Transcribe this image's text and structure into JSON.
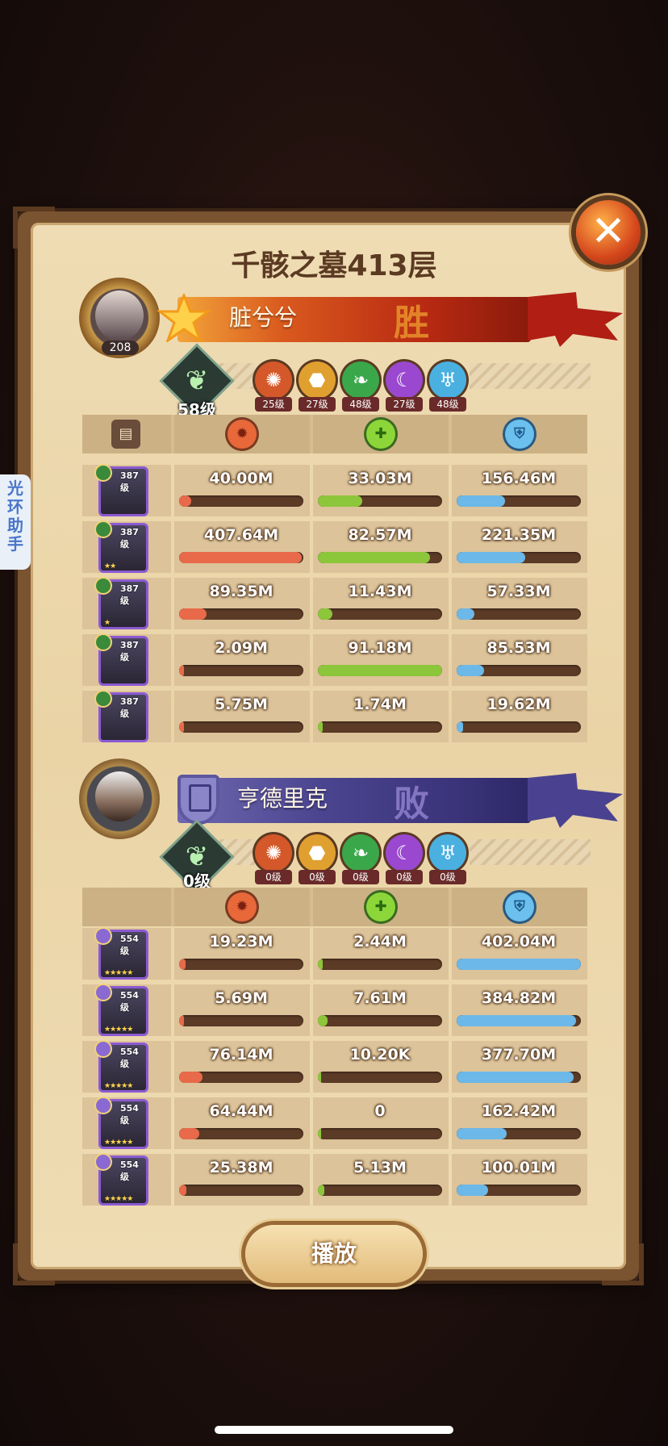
{
  "title": "千骸之墓413层",
  "close_label": "✕",
  "side_tab": {
    "line1": "光",
    "line2": "环",
    "line3": "助",
    "line4": "手"
  },
  "play_label": "播放",
  "colors": {
    "damage_bar": "#e86a4a",
    "heal_bar": "#8cc63a",
    "shield_bar": "#6cb8e8"
  },
  "stat_icons": {
    "damage": "damage-icon",
    "heal": "heal-icon",
    "shield": "shield-icon"
  },
  "team1": {
    "player_name": "脏兮兮",
    "avatar_level": "208",
    "result": "胜",
    "tree_level": "58级",
    "factions": [
      {
        "name": "lightbearer-icon",
        "level": "25级",
        "color": "#d4582a"
      },
      {
        "name": "mauler-icon",
        "level": "27级",
        "color": "#e0a030"
      },
      {
        "name": "wilder-icon",
        "level": "48级",
        "color": "#3aa84a"
      },
      {
        "name": "graveborn-icon",
        "level": "27级",
        "color": "#9a48d0"
      },
      {
        "name": "celestial-icon",
        "level": "48级",
        "color": "#4ab0e0"
      }
    ],
    "heroes": [
      {
        "level": "387级",
        "stars": "",
        "damage": "40.00M",
        "heal": "33.03M",
        "shield": "156.46M",
        "damage_frac": 0.1,
        "heal_frac": 0.36,
        "shield_frac": 0.39
      },
      {
        "level": "387级",
        "stars": "★★",
        "damage": "407.64M",
        "heal": "82.57M",
        "shield": "221.35M",
        "damage_frac": 0.99,
        "heal_frac": 0.9,
        "shield_frac": 0.55
      },
      {
        "level": "387级",
        "stars": "★",
        "damage": "89.35M",
        "heal": "11.43M",
        "shield": "57.33M",
        "damage_frac": 0.22,
        "heal_frac": 0.12,
        "shield_frac": 0.14
      },
      {
        "level": "387级",
        "stars": "",
        "damage": "2.09M",
        "heal": "91.18M",
        "shield": "85.53M",
        "damage_frac": 0.01,
        "heal_frac": 1.0,
        "shield_frac": 0.22
      },
      {
        "level": "387级",
        "stars": "",
        "damage": "5.75M",
        "heal": "1.74M",
        "shield": "19.62M",
        "damage_frac": 0.02,
        "heal_frac": 0.02,
        "shield_frac": 0.05
      }
    ]
  },
  "team2": {
    "player_name": "亨德里克",
    "result": "败",
    "tree_level": "0级",
    "factions": [
      {
        "name": "lightbearer-icon",
        "level": "0级",
        "color": "#d4582a"
      },
      {
        "name": "mauler-icon",
        "level": "0级",
        "color": "#e0a030"
      },
      {
        "name": "wilder-icon",
        "level": "0级",
        "color": "#3aa84a"
      },
      {
        "name": "graveborn-icon",
        "level": "0级",
        "color": "#9a48d0"
      },
      {
        "name": "celestial-icon",
        "level": "0级",
        "color": "#4ab0e0"
      }
    ],
    "heroes": [
      {
        "level": "554级",
        "stars": "★★★★★",
        "damage": "19.23M",
        "heal": "2.44M",
        "shield": "402.04M",
        "damage_frac": 0.05,
        "heal_frac": 0.03,
        "shield_frac": 1.0
      },
      {
        "level": "554级",
        "stars": "★★★★★",
        "damage": "5.69M",
        "heal": "7.61M",
        "shield": "384.82M",
        "damage_frac": 0.02,
        "heal_frac": 0.08,
        "shield_frac": 0.96
      },
      {
        "level": "554级",
        "stars": "★★★★★",
        "damage": "76.14M",
        "heal": "10.20K",
        "shield": "377.70M",
        "damage_frac": 0.19,
        "heal_frac": 0.0,
        "shield_frac": 0.94
      },
      {
        "level": "554级",
        "stars": "★★★★★",
        "damage": "64.44M",
        "heal": "0",
        "shield": "162.42M",
        "damage_frac": 0.16,
        "heal_frac": 0.0,
        "shield_frac": 0.4
      },
      {
        "level": "554级",
        "stars": "★★★★★",
        "damage": "25.38M",
        "heal": "5.13M",
        "shield": "100.01M",
        "damage_frac": 0.06,
        "heal_frac": 0.05,
        "shield_frac": 0.25
      }
    ]
  }
}
